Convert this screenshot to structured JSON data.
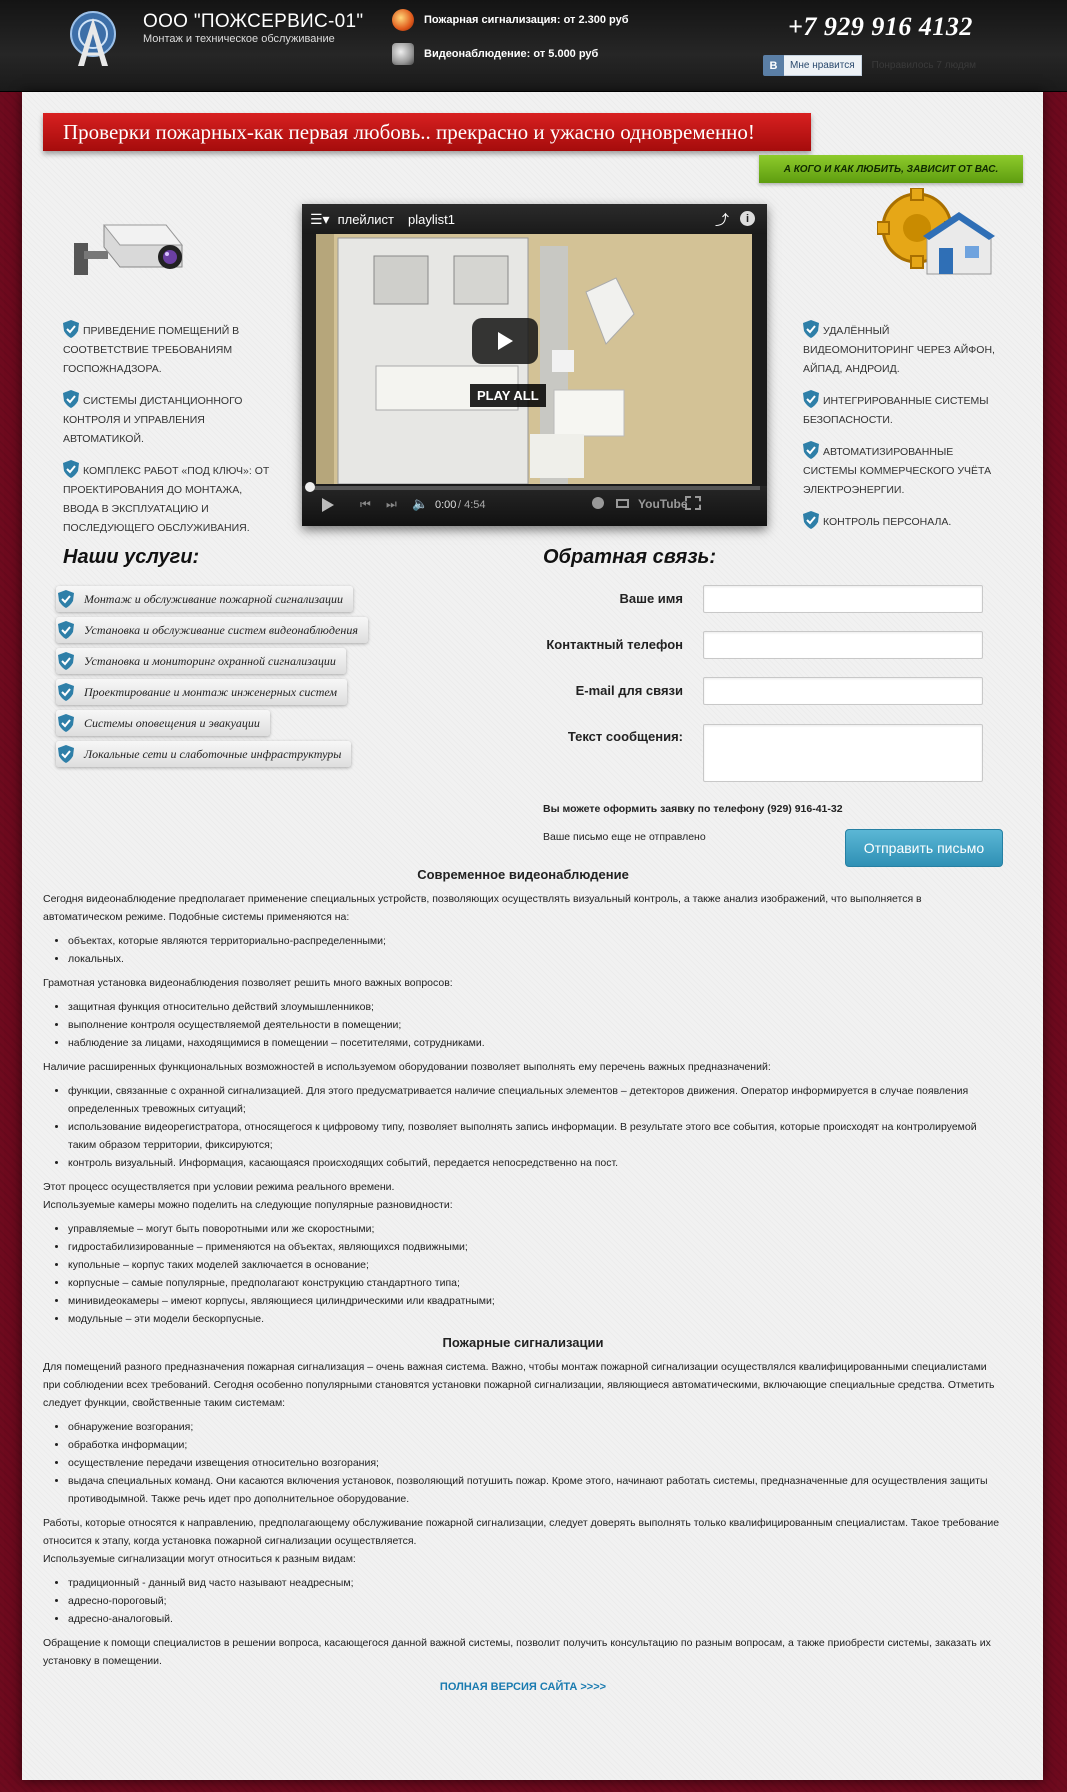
{
  "header": {
    "company_name": "ООО \"ПОЖСЕРВИС-01\"",
    "company_sub": "Монтаж и техническое обслуживание",
    "offer1": "Пожарная сигнализация: от 2.300 руб",
    "offer2": "Видеонаблюдение: от 5.000 руб",
    "phone": "+7 929 916 4132",
    "vk_logo": "В",
    "vk_like": "Мне нравится",
    "vk_count": "Понравилось 7 людям"
  },
  "banner": {
    "title": "Проверки пожарных-как первая любовь.. прекрасно и ужасно одновременно!",
    "tag": "А КОГО И КАК ЛЮБИТЬ, ЗАВИСИТ ОТ ВАС."
  },
  "features_left": [
    "Приведение помещений в соответствие требованиям Госпожнадзора.",
    "Системы дистанционного контроля и управления автоматикой.",
    "Комплекс работ «под ключ»: от проектирования до монтажа, ввода в эксплуатацию и последующего обслуживания."
  ],
  "features_right": [
    "Удалённый видеомониторинг через айфон, айпад, андроид.",
    "Интегрированные системы безопасности.",
    "Автоматизированные системы коммерческого учёта электроэнергии.",
    "Контроль персонала."
  ],
  "video": {
    "playlist_label": "плейлист",
    "playlist_name": "playlist1",
    "play_all": "PLAY ALL",
    "time_current": "0:00",
    "time_total": "/ 4:54",
    "youtube": "YouTube"
  },
  "services": {
    "title": "Наши услуги:",
    "items": [
      "Монтаж и обслуживание пожарной сигнализации",
      "Установка и обслуживание систем видеонаблюдения",
      "Установка  и мониторинг охранной сигнализации",
      "Проектирование и монтаж инженерных систем",
      "Системы оповещения и эвакуации",
      "Локальные сети и слаботочные инфраструктуры"
    ]
  },
  "form": {
    "title": "Обратная связь:",
    "name_label": "Ваше имя",
    "phone_label": "Контактный телефон",
    "email_label": "E-mail для связи",
    "message_label": "Текст сообщения:",
    "phone_note": "Вы можете оформить заявку по телефону (929) 916-41-32",
    "status": "Ваше письмо еще не отправлено",
    "submit": "Отправить письмо"
  },
  "article": {
    "h1": "Современное видеонаблюдение",
    "p1": "Сегодня видеонаблюдение предполагает применение специальных устройств, позволяющих осуществлять визуальный контроль, а также анализ изображений, что выполняется в автоматическом режиме. Подобные системы применяются на:",
    "l1": [
      "объектах, которые являются территориально-распределенными;",
      "локальных."
    ],
    "p2": "Грамотная установка видеонаблюдения позволяет решить много важных вопросов:",
    "l2": [
      "защитная функция относительно действий злоумышленников;",
      "выполнение контроля осуществляемой деятельности в помещении;",
      "наблюдение за лицами, находящимися в помещении – посетителями, сотрудниками."
    ],
    "p3": "Наличие расширенных функциональных возможностей в используемом оборудовании позволяет выполнять ему перечень важных предназначений:",
    "l3": [
      "функции, связанные с охранной сигнализацией. Для этого предусматривается наличие специальных элементов – детекторов движения. Оператор информируется в случае появления определенных тревожных ситуаций;",
      "использование видеорегистратора, относящегося к цифровому типу, позволяет выполнять запись информации. В результате этого все события, которые происходят на контролируемой таким образом территории, фиксируются;",
      "контроль визуальный. Информация, касающаяся происходящих событий, передается непосредственно на пост."
    ],
    "p4a": "Этот процесс осуществляется при условии режима реального времени.",
    "p4b": "Используемые камеры можно поделить на следующие популярные разновидности:",
    "l4": [
      "управляемые – могут быть поворотными или же скоростными;",
      "гидростабилизированные – применяются на объектах, являющихся подвижными;",
      "купольные – корпус таких моделей заключается в основание;",
      "корпусные – самые популярные, предполагают конструкцию стандартного типа;",
      "минивидеокамеры – имеют корпусы, являющиеся цилиндрическими или квадратными;",
      "модульные – эти модели бескорпусные."
    ],
    "h2": "Пожарные сигнализации",
    "p5": "Для помещений разного предназначения пожарная сигнализация – очень важная система. Важно, чтобы монтаж пожарной сигнализации осуществлялся квалифицированными специалистами при соблюдении всех требований. Сегодня особенно популярными становятся установки пожарной сигнализации, являющиеся автоматическими, включающие специальные средства. Отметить следует функции, свойственные таким системам:",
    "l5": [
      "обнаружение возгорания;",
      "обработка информации;",
      "осуществление передачи извещения относительно возгорания;",
      "выдача специальных команд. Они касаются включения установок, позволяющий потушить пожар. Кроме этого, начинают работать системы, предназначенные для осуществления защиты противодымной. Также речь идет про дополнительное оборудование."
    ],
    "p6a": "Работы, которые относятся к направлению, предполагающему обслуживание пожарной сигнализации, следует доверять выполнять только квалифицированным специалистам. Такое требование относится к этапу, когда установка пожарной сигнализации осуществляется.",
    "p6b": "Используемые сигнализации могут относиться к разным видам:",
    "l6": [
      "традиционный - данный вид часто называют неадресным;",
      "адресно-пороговый;",
      "адресно-аналоговый."
    ],
    "p7": "Обращение к помощи специалистов в решении вопроса, касающегося данной важной системы, позволит получить консультацию по разным вопросам, а также приобрести системы, заказать их установку в помещении.",
    "full_link": "ПОЛНАЯ ВЕРСИЯ САЙТА >>>>"
  },
  "colors": {
    "accent_red": "#c41414",
    "accent_green": "#7bbd22",
    "button_blue": "#3fa3c6",
    "background": "#6e0a1e"
  }
}
